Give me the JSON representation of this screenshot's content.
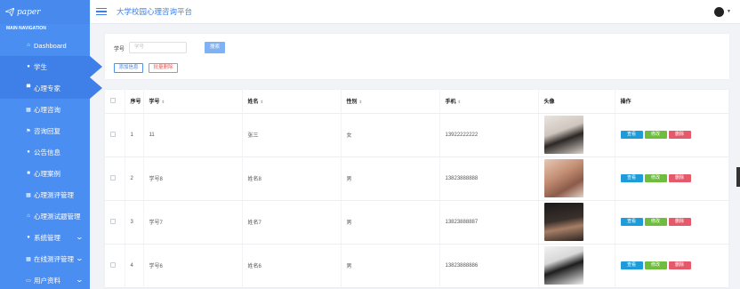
{
  "brand": {
    "name": "paper"
  },
  "nav": {
    "header": "MAIN NAVIGATION",
    "items": [
      {
        "label": "Dashboard",
        "icon": "home-icon",
        "glyph": "⌂"
      },
      {
        "label": "学生",
        "icon": "user-icon",
        "glyph": "●"
      },
      {
        "label": "心理专家",
        "icon": "card-icon",
        "glyph": "▀"
      },
      {
        "label": "心理咨询",
        "icon": "grid-icon",
        "glyph": "▦"
      },
      {
        "label": "咨询回复",
        "icon": "flag-icon",
        "glyph": "⚑"
      },
      {
        "label": "公告信息",
        "icon": "user-icon",
        "glyph": "●"
      },
      {
        "label": "心理案例",
        "icon": "book-icon",
        "glyph": "■"
      },
      {
        "label": "心理测评管理",
        "icon": "grid-icon",
        "glyph": "▦"
      },
      {
        "label": "心理测试题管理",
        "icon": "bank-icon",
        "glyph": "⌂"
      },
      {
        "label": "系统管理",
        "icon": "database-icon",
        "glyph": "●"
      },
      {
        "label": "在线测评管理",
        "icon": "grid-icon",
        "glyph": "▦"
      },
      {
        "label": "用户资料",
        "icon": "window-icon",
        "glyph": "▭"
      }
    ]
  },
  "header": {
    "title": "大学校园心理咨询平台"
  },
  "search": {
    "label": "学号",
    "placeholder": "学号",
    "button": "搜索",
    "add": "添加信息",
    "batch_delete": "批量删除"
  },
  "table": {
    "columns": [
      "序号",
      "学号",
      "姓名",
      "性别",
      "手机",
      "头像",
      "操作"
    ],
    "rows": [
      {
        "index": "1",
        "student_no": "11",
        "name": "张三",
        "gender": "女",
        "phone": "13922222222"
      },
      {
        "index": "2",
        "student_no": "学号8",
        "name": "姓名8",
        "gender": "男",
        "phone": "13823888888"
      },
      {
        "index": "3",
        "student_no": "学号7",
        "name": "姓名7",
        "gender": "男",
        "phone": "13823888887"
      },
      {
        "index": "4",
        "student_no": "学号6",
        "name": "姓名6",
        "gender": "男",
        "phone": "13823888886"
      }
    ],
    "actions": {
      "view": "查看",
      "edit": "修改",
      "delete": "删除"
    }
  },
  "colors": {
    "sidebar": "#4b8ef1",
    "accent": "#3d7fe6",
    "view": "#1d9cd9",
    "edit": "#6fbd3f",
    "delete": "#e45a6b"
  }
}
